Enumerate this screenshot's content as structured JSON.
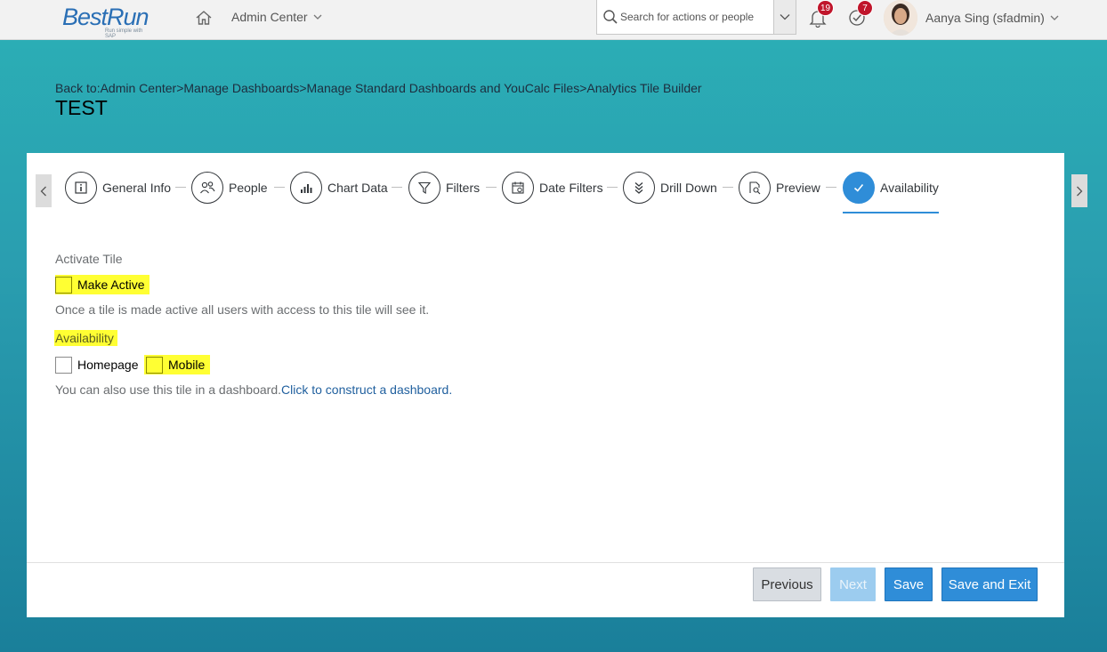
{
  "header": {
    "logo_text": "BestRun",
    "logo_tagline": "Run simple with SAP",
    "admin_menu_label": "Admin Center",
    "search_placeholder": "Search for actions or people",
    "notifications_count": "19",
    "todo_count": "7",
    "user_name": "Aanya Sing (sfadmin)"
  },
  "breadcrumb": {
    "prefix": "Back to:",
    "items": [
      "Admin Center",
      "Manage Dashboards",
      "Manage Standard Dashboards and YouCalc Files",
      "Analytics Tile Builder"
    ],
    "separator": ">"
  },
  "page_title": "TEST",
  "steps": [
    {
      "label": "General Info",
      "icon": "info-icon"
    },
    {
      "label": "People",
      "icon": "people-icon"
    },
    {
      "label": "Chart Data",
      "icon": "bar-chart-icon"
    },
    {
      "label": "Filters",
      "icon": "filter-icon"
    },
    {
      "label": "Date Filters",
      "icon": "calendar-icon"
    },
    {
      "label": "Drill Down",
      "icon": "drill-down-icon"
    },
    {
      "label": "Preview",
      "icon": "preview-icon"
    },
    {
      "label": "Availability",
      "icon": "checkmark-icon",
      "active": true
    }
  ],
  "content": {
    "activate_section_label": "Activate Tile",
    "make_active_label": "Make Active",
    "make_active_help": "Once a tile is made active all users with access to this tile will see it.",
    "availability_label": "Availability",
    "homepage_label": "Homepage",
    "mobile_label": "Mobile",
    "dashboard_help_prefix": "You can also use this tile in a dashboard.",
    "dashboard_link": "Click to construct a dashboard."
  },
  "footer": {
    "previous": "Previous",
    "next": "Next",
    "save": "Save",
    "save_and_exit": "Save and Exit"
  },
  "colors": {
    "accent": "#2f8dd8",
    "highlight": "#ffff33",
    "badge": "#c0152b"
  }
}
